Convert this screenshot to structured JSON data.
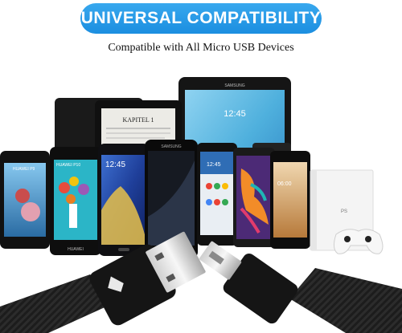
{
  "header": {
    "banner_title": "UNIVERSAL COMPATIBILITY",
    "subtitle": "Compatible with All Micro USB Devices"
  },
  "devices": {
    "tablet_brand": "SAMSUNG",
    "tablet_time": "12:45",
    "ereader_title": "KAPITEL 1",
    "phone_huawei_label": "HUAWEI P9",
    "phone_huawei_brand": "HUAWEI",
    "phone_huawei_p10": "HUAWEI P10",
    "phone_galaxy_time": "12:45",
    "phone_samsung_brand": "SAMSUNG",
    "phone_motorola_time": "12:45",
    "phone_nokia_time": "06:00",
    "console_logo": "PS"
  },
  "colors": {
    "banner_blue": "#1b8ee0",
    "cable_black": "#1c1c1c"
  }
}
